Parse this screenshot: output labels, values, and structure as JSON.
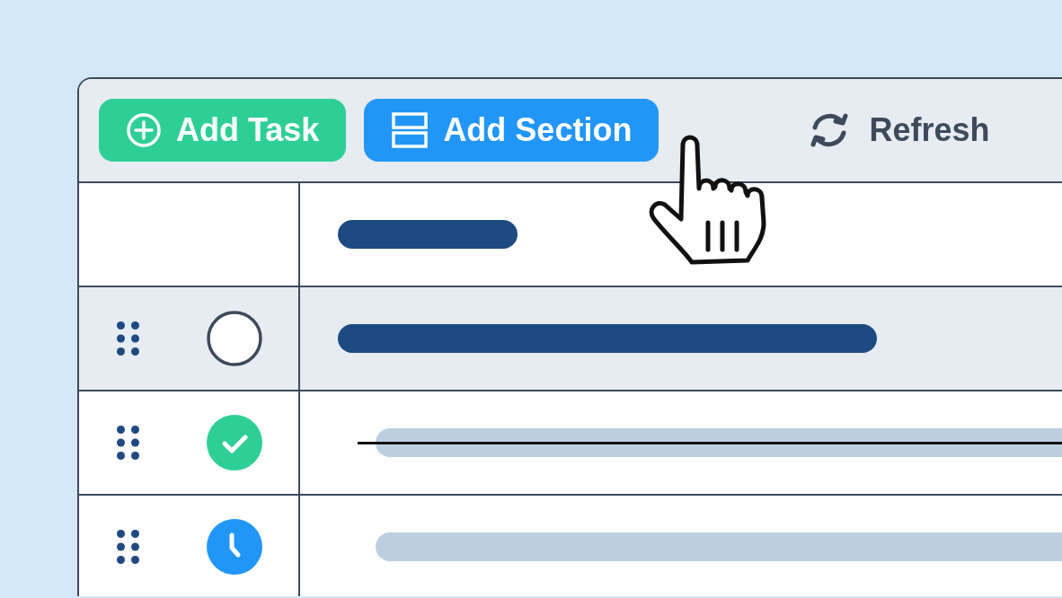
{
  "toolbar": {
    "buttons": [
      {
        "kind": "add_task",
        "label": "Add Task"
      },
      {
        "kind": "add_section",
        "label": "Add Section"
      },
      {
        "kind": "refresh",
        "label": "Refresh"
      }
    ]
  },
  "table": {
    "rows": [
      {
        "kind": "open",
        "selected": true
      },
      {
        "kind": "done",
        "selected": false
      },
      {
        "kind": "scheduled",
        "selected": false
      }
    ]
  }
}
